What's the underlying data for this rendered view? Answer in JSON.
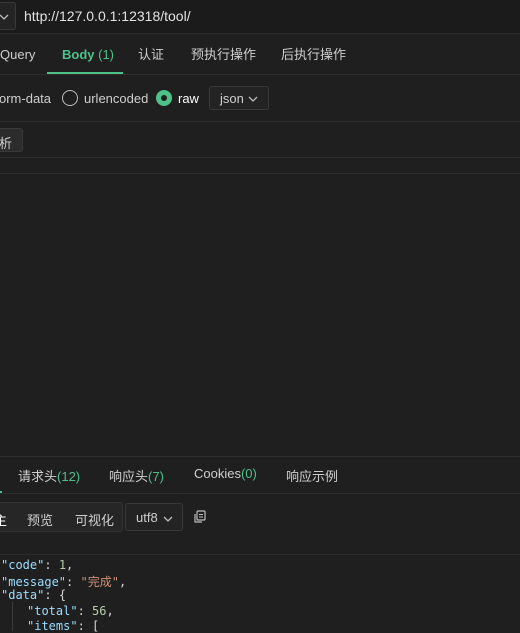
{
  "url": {
    "value": "http://127.0.0.1:12318/tool/"
  },
  "request_tabs": {
    "query": "Query",
    "body": "Body",
    "body_count": "(1)",
    "auth": "认证",
    "pre_ops": "预执行操作",
    "post_ops": "后执行操作"
  },
  "body_types": {
    "form_data": "orm-data",
    "urlencoded": "urlencoded",
    "raw": "raw",
    "raw_format": "json",
    "selected": "raw"
  },
  "parse_button": "析",
  "response_tabs": {
    "req_headers": "请求头",
    "req_headers_count": "(12)",
    "resp_headers": "响应头",
    "resp_headers_count": "(7)",
    "cookies": "Cookies",
    "cookies_count": "(0)",
    "example": "响应示例"
  },
  "view_modes": {
    "pretty": "主",
    "preview": "预览",
    "visualize": "可视化"
  },
  "encoding": "utf8",
  "response_code": [
    {
      "key": "\"code\"",
      "sep": ": ",
      "value": "1",
      "vtype": "num",
      "tail": ","
    },
    {
      "key": "\"message\"",
      "sep": ": ",
      "value": "\"完成\"",
      "vtype": "str",
      "tail": ","
    },
    {
      "key": "\"data\"",
      "sep": ": ",
      "value": "{",
      "vtype": "plain",
      "tail": ""
    },
    {
      "key": "\"total\"",
      "sep": ": ",
      "value": "56",
      "vtype": "num",
      "tail": ","
    },
    {
      "key": "\"items\"",
      "sep": ": ",
      "value": "[",
      "vtype": "plain",
      "tail": ""
    }
  ],
  "colors": {
    "accent": "#4ec08a",
    "background": "#1f1f1f"
  }
}
